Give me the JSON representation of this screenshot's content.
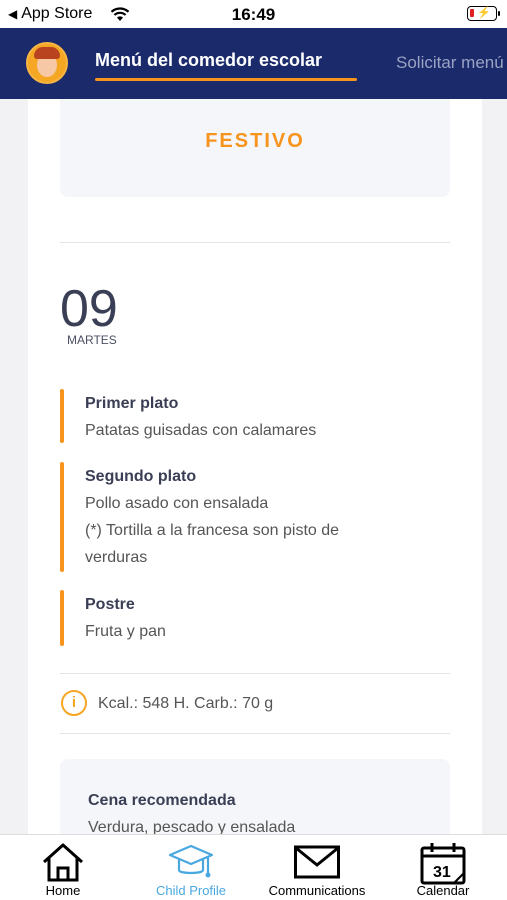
{
  "status_bar": {
    "back_app": "App Store",
    "time": "16:49"
  },
  "header": {
    "active_tab": "Menú del comedor escolar",
    "second_tab": "Solicitar menú"
  },
  "holiday": {
    "label": "FESTIVO"
  },
  "day": {
    "number": "09",
    "name": "MARTES"
  },
  "courses": [
    {
      "title": "Primer plato",
      "lines": [
        "Patatas guisadas con calamares"
      ]
    },
    {
      "title": "Segundo plato",
      "lines": [
        "Pollo asado con ensalada",
        "(*) Tortilla a la francesa son pisto de",
        "verduras"
      ]
    },
    {
      "title": "Postre",
      "lines": [
        "Fruta y pan"
      ]
    }
  ],
  "nutrition": {
    "icon": "info-icon",
    "text": "Kcal.: 548 H. Carb.: 70 g"
  },
  "dinner": {
    "title": "Cena recomendada",
    "text": "Verdura, pescado y ensalada"
  },
  "tab_bar": {
    "items": [
      {
        "label": "Home",
        "icon": "home-icon"
      },
      {
        "label": "Child Profile",
        "icon": "graduation-cap-icon",
        "active": true
      },
      {
        "label": "Communications",
        "icon": "envelope-icon"
      },
      {
        "label": "Calendar",
        "icon": "calendar-icon",
        "calendar_day": "31"
      }
    ]
  },
  "colors": {
    "header_bg": "#1b2a6b",
    "accent": "#f7941d",
    "active_tab": "#4aa8e0"
  }
}
